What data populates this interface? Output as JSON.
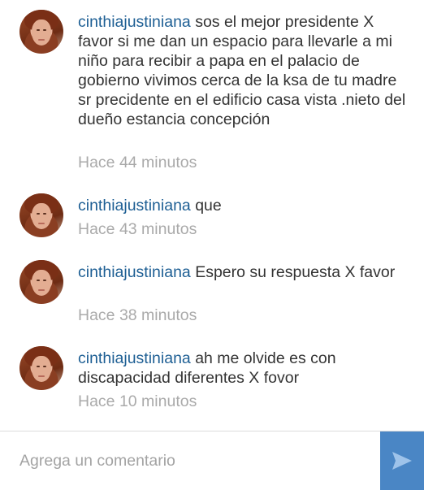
{
  "comments": [
    {
      "username": "cinthiajustiniana",
      "text": "sos  el mejor  presidente  X favor  si me dan  un espacio  para  llevarle  a mi  niño  para  recibir  a papa  en el palacio  de gobierno  vivimos  cerca  de la ksa  de tu madre  sr  precidente  en el edificio  casa  vista .nieto del dueño estancia  concepción",
      "time": "Hace 44 minutos"
    },
    {
      "username": "cinthiajustiniana",
      "text": "que",
      "time": "Hace 43 minutos"
    },
    {
      "username": "cinthiajustiniana",
      "text": "Espero  su respuesta  X favor",
      "time": "Hace 38 minutos"
    },
    {
      "username": "cinthiajustiniana",
      "text": "ah me olvide  es con discapacidad  diferentes  X fovor",
      "time": "Hace 10 minutos"
    }
  ],
  "composer": {
    "placeholder": "Agrega un comentario",
    "send_icon": "send-arrow-icon",
    "send_color": "#4a86c5"
  }
}
